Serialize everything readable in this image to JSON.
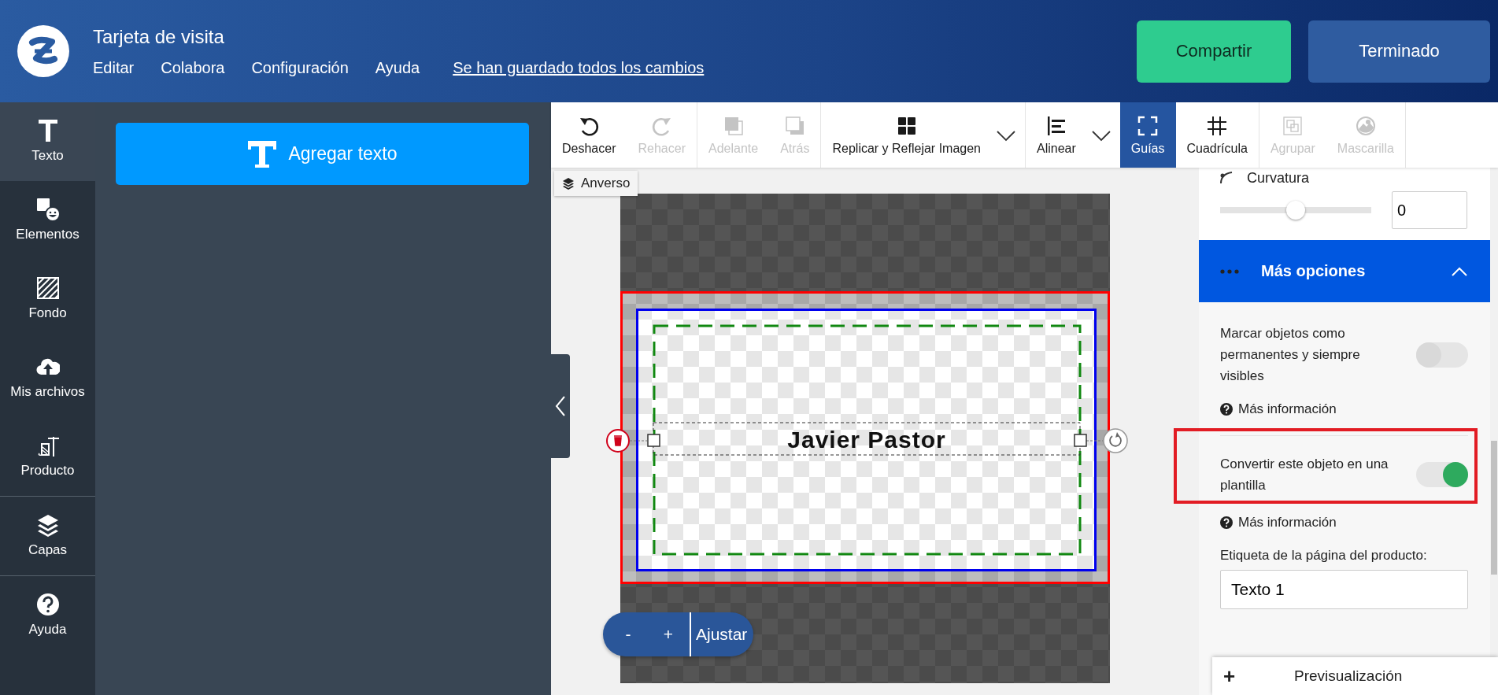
{
  "header": {
    "title": "Tarjeta de visita",
    "menu": [
      "Editar",
      "Colabora",
      "Configuración",
      "Ayuda"
    ],
    "save_status": "Se han guardado todos los cambios",
    "buttons": [
      {
        "label": "Compartir",
        "kind": "primary"
      },
      {
        "label": "Terminado",
        "kind": "secondary"
      }
    ]
  },
  "rail": {
    "groups": [
      [
        {
          "label": "Texto",
          "kind": "text",
          "selected": true
        },
        {
          "label": "Elementos",
          "kind": "elements",
          "selected": false
        },
        {
          "label": "Fondo",
          "kind": "background",
          "selected": false
        },
        {
          "label": "Mis archivos",
          "kind": "uploads",
          "selected": false
        },
        {
          "label": "Producto",
          "kind": "product",
          "selected": false
        }
      ],
      [
        {
          "label": "Capas",
          "kind": "layers",
          "selected": false
        }
      ],
      [
        {
          "label": "Ayuda",
          "kind": "help",
          "selected": false
        }
      ]
    ]
  },
  "panel": {
    "add_text_button": "Agregar texto"
  },
  "toolbar": {
    "groups": [
      [
        {
          "label": "Deshacer",
          "kind": "undo",
          "disabled": false,
          "selected": false,
          "dropdown": false
        },
        {
          "label": "Rehacer",
          "kind": "redo",
          "disabled": true,
          "selected": false,
          "dropdown": false
        }
      ],
      [
        {
          "label": "Adelante",
          "kind": "forward",
          "disabled": true,
          "selected": false,
          "dropdown": false
        },
        {
          "label": "Atrás",
          "kind": "backward",
          "disabled": true,
          "selected": false,
          "dropdown": false
        }
      ],
      [
        {
          "label": "Replicar y Reflejar Imagen",
          "kind": "replicate",
          "disabled": false,
          "selected": false,
          "dropdown": true
        }
      ],
      [
        {
          "label": "Alinear",
          "kind": "align",
          "disabled": false,
          "selected": false,
          "dropdown": true
        },
        {
          "label": "Guías",
          "kind": "guides",
          "disabled": false,
          "selected": true,
          "dropdown": false
        },
        {
          "label": "Cuadrícula",
          "kind": "grid",
          "disabled": false,
          "selected": false,
          "dropdown": false
        }
      ],
      [
        {
          "label": "Agrupar",
          "kind": "group",
          "disabled": true,
          "selected": false,
          "dropdown": false
        },
        {
          "label": "Mascarilla",
          "kind": "mask",
          "disabled": true,
          "selected": false,
          "dropdown": false
        }
      ]
    ]
  },
  "canvas": {
    "side_tab": "Anverso",
    "text": "Javier Pastor",
    "zoom": {
      "minus": "-",
      "plus": "+",
      "fit": "Ajustar"
    }
  },
  "properties": {
    "curvature": {
      "label": "Curvatura",
      "level": 0.5,
      "value": "0"
    },
    "more_options": {
      "title": "Más opciones",
      "expanded": true
    },
    "options": [
      {
        "label": "Marcar objetos como permanentes y siempre visibles",
        "on": false,
        "highlighted": false,
        "help": "Más información"
      },
      {
        "label": "Convertir este objeto en una plantilla",
        "on": true,
        "highlighted": true,
        "help": "Más información"
      }
    ],
    "page_label": {
      "label": "Etiqueta de la página del producto:",
      "value": "Texto 1"
    },
    "preview": {
      "icon": "+",
      "label": "Previsualización"
    }
  }
}
